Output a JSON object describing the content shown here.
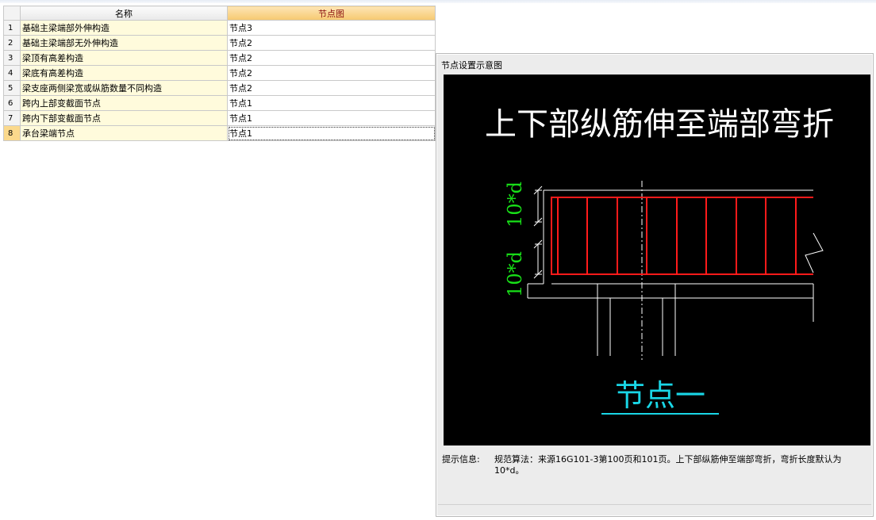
{
  "grid": {
    "headers": {
      "name": "名称",
      "node": "节点图"
    },
    "rows": [
      {
        "index": "1",
        "name": "基础主梁端部外伸构造",
        "node": "节点3"
      },
      {
        "index": "2",
        "name": "基础主梁端部无外伸构造",
        "node": "节点2"
      },
      {
        "index": "3",
        "name": "梁顶有高差构造",
        "node": "节点2"
      },
      {
        "index": "4",
        "name": "梁底有高差构造",
        "node": "节点2"
      },
      {
        "index": "5",
        "name": "梁支座两侧梁宽或纵筋数量不同构造",
        "node": "节点2"
      },
      {
        "index": "6",
        "name": "跨内上部变截面节点",
        "node": "节点1"
      },
      {
        "index": "7",
        "name": "跨内下部变截面节点",
        "node": "节点1"
      },
      {
        "index": "8",
        "name": "承台梁端节点",
        "node": "节点1"
      }
    ],
    "selected_index": "8"
  },
  "panel": {
    "title": "节点设置示意图",
    "diagram": {
      "heading": "上下部纵筋伸至端部弯折",
      "dim_top": "10*d",
      "dim_bottom": "10*d",
      "caption": "节点一",
      "colors": {
        "background": "#000000",
        "heading": "#ffffff",
        "rebar": "#ff1a1a",
        "dimension": "#18e018",
        "caption": "#19d6e6",
        "outline": "#ffffff"
      }
    },
    "hint_label": "提示信息:",
    "hint_text": "规范算法：来源16G101-3第100页和101页。上下部纵筋伸至端部弯折，弯折长度默认为10*d。"
  }
}
